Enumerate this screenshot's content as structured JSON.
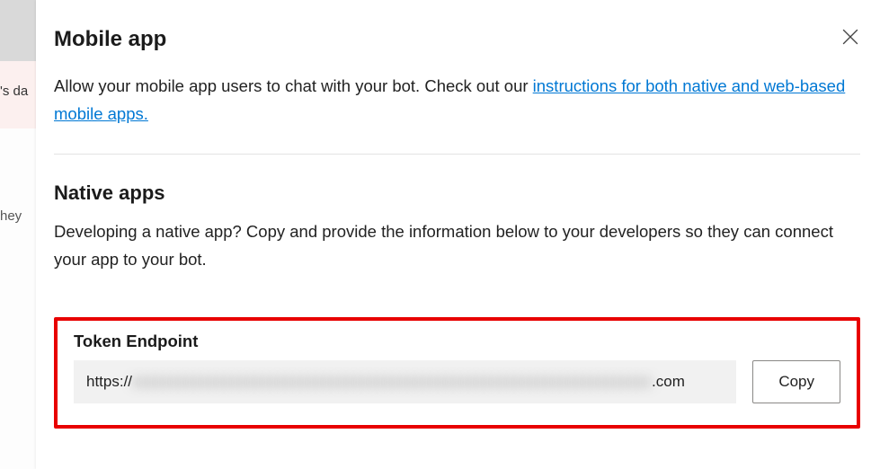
{
  "bg": {
    "banner_fragment": "'s da",
    "text_fragment": "hey "
  },
  "panel": {
    "title": "Mobile app",
    "description_before_link": "Allow your mobile app users to chat with your bot. Check out our ",
    "link_text": "instructions for both native and web-based mobile apps.",
    "native": {
      "title": "Native apps",
      "desc": "Developing a native app? Copy and provide the information below to your developers so they can connect your app to your bot."
    },
    "endpoint": {
      "label": "Token Endpoint",
      "prefix": "https://",
      "blurred": "xxxxxxxxxxxxxxxxxxxxxxxxxxxxxxxxxxxxxxxxxxxxxxxxxxxxxxxxxxxxxxxxxxxx",
      "suffix": ".com",
      "copy": "Copy"
    }
  }
}
